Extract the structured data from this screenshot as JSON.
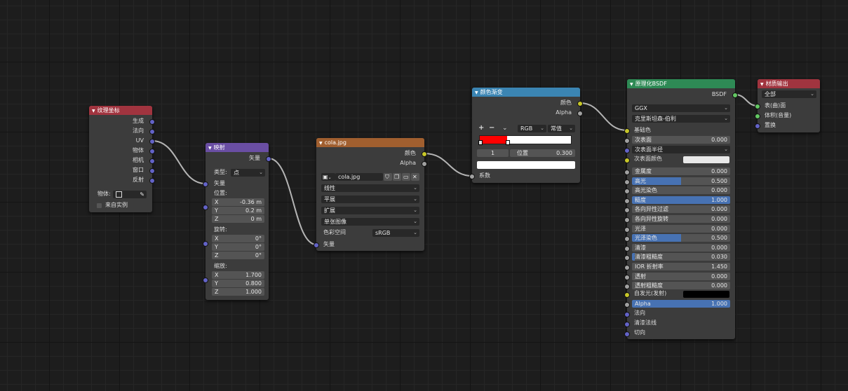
{
  "nodes": {
    "texcoord": {
      "title": "纹理坐标",
      "outputs": [
        "生成",
        "法向",
        "UV",
        "物体",
        "相机",
        "窗口",
        "反射"
      ],
      "object_label": "物体:",
      "instancer_label": "来自实例"
    },
    "mapping": {
      "title": "映射",
      "output": "矢量",
      "type_label": "类型:",
      "type_value": "点",
      "vector_input": "矢量",
      "location_label": "位置:",
      "location": [
        {
          "axis": "X",
          "value": "-0.36 m"
        },
        {
          "axis": "Y",
          "value": "0.2 m"
        },
        {
          "axis": "Z",
          "value": "0 m"
        }
      ],
      "rotation_label": "旋转:",
      "rotation": [
        {
          "axis": "X",
          "value": "0°"
        },
        {
          "axis": "Y",
          "value": "0°"
        },
        {
          "axis": "Z",
          "value": "0°"
        }
      ],
      "scale_label": "缩放:",
      "scale": [
        {
          "axis": "X",
          "value": "1.700"
        },
        {
          "axis": "Y",
          "value": "0.800"
        },
        {
          "axis": "Z",
          "value": "1.000"
        }
      ]
    },
    "image": {
      "title": "cola.jpg",
      "out_color": "颜色",
      "out_alpha": "Alpha",
      "image_name": "cola.jpg",
      "interpolation": "线性",
      "projection": "平展",
      "extension": "扩展",
      "source": "单张图像",
      "colorspace_label": "色彩空间",
      "colorspace_value": "sRGB",
      "vector_input": "矢量"
    },
    "ramp": {
      "title": "颜色渐变",
      "out_color": "颜色",
      "out_alpha": "Alpha",
      "plus": "+",
      "minus": "−",
      "color_mode": "RGB",
      "interpolation": "常值",
      "stop_index": "1",
      "pos_label": "位置",
      "pos_value": "0.300",
      "stop_position": 0.3,
      "color_stop_left": "#ff0000",
      "color_stop_right": "#ffffff",
      "fac_input": "系数"
    },
    "bsdf": {
      "title": "原理化BSDF",
      "output": "BSDF",
      "distribution": "GGX",
      "subsurface_method": "克里斯坦森-伯利",
      "base_color": "基础色",
      "subsurface": {
        "label": "次表面",
        "value": "0.000"
      },
      "subsurface_radius": "次表面半径",
      "subsurface_color": "次表面颜色",
      "subsurface_color_hex": "#e8e8e8",
      "params": [
        {
          "label": "金属度",
          "value": "0.000",
          "fill": 0.0
        },
        {
          "label": "高光",
          "value": "0.500",
          "fill": 0.5
        },
        {
          "label": "高光染色",
          "value": "0.000",
          "fill": 0.0
        },
        {
          "label": "糙度",
          "value": "1.000",
          "fill": 1.0
        },
        {
          "label": "各向异性过滤",
          "value": "0.000",
          "fill": 0.0
        },
        {
          "label": "各向异性旋转",
          "value": "0.000",
          "fill": 0.0
        },
        {
          "label": "光泽",
          "value": "0.000",
          "fill": 0.0
        },
        {
          "label": "光泽染色",
          "value": "0.500",
          "fill": 0.5
        },
        {
          "label": "清漆",
          "value": "0.000",
          "fill": 0.0
        },
        {
          "label": "清漆粗糙度",
          "value": "0.030",
          "fill": 0.03
        },
        {
          "label": "IOR 折射率",
          "value": "1.450",
          "fill": 0.0
        },
        {
          "label": "透射",
          "value": "0.000",
          "fill": 0.0
        },
        {
          "label": "透射粗糙度",
          "value": "0.000",
          "fill": 0.0
        }
      ],
      "emission": "自发光(发射)",
      "emission_hex": "#000000",
      "alpha": {
        "label": "Alpha",
        "value": "1.000",
        "fill": 1.0
      },
      "normal": "法向",
      "clearcoat_normal": "清漆法线",
      "tangent": "切向"
    },
    "output": {
      "title": "材质输出",
      "target": "全部",
      "inputs": [
        "表(曲)面",
        "体积(音量)",
        "置换"
      ]
    }
  },
  "colors": {
    "header_input": "#a1343f",
    "header_vector": "#6a4ea3",
    "header_texture": "#a15f2f",
    "header_converter": "#3b85b3",
    "header_shader": "#2e8a55",
    "header_output": "#a1343f",
    "accent_fill": "#4772b3"
  }
}
